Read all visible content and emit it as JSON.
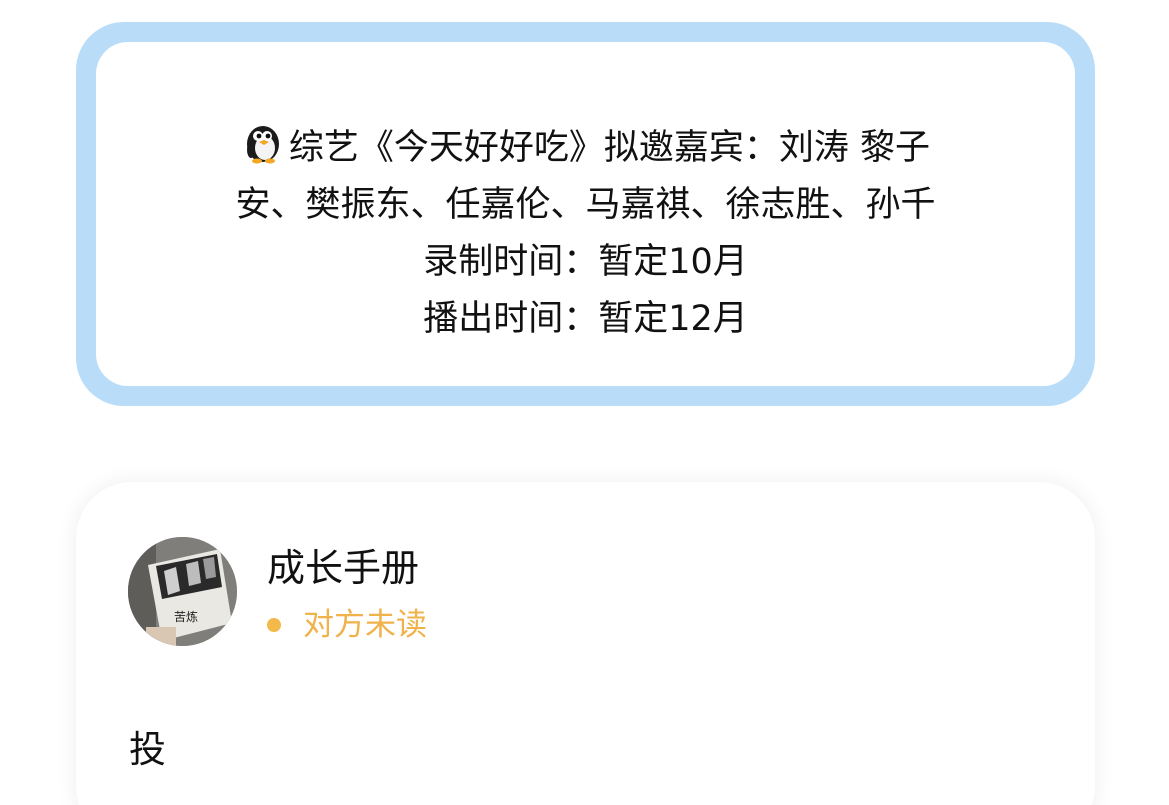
{
  "notice": {
    "icon": "penguin-icon",
    "lines": [
      "综艺《今天好好吃》拟邀嘉宾：刘涛 黎子",
      "安、樊振东、任嘉伦、马嘉祺、徐志胜、孙千",
      "录制时间：暂定10月",
      "播出时间：暂定12月"
    ],
    "border_color": "#b9ddf9"
  },
  "message": {
    "avatar_icon": "book-cover-avatar",
    "avatar_text": "苦炼",
    "sender": "成长手册",
    "status": "对方未读",
    "status_color": "#f0b24b",
    "body": "投"
  }
}
